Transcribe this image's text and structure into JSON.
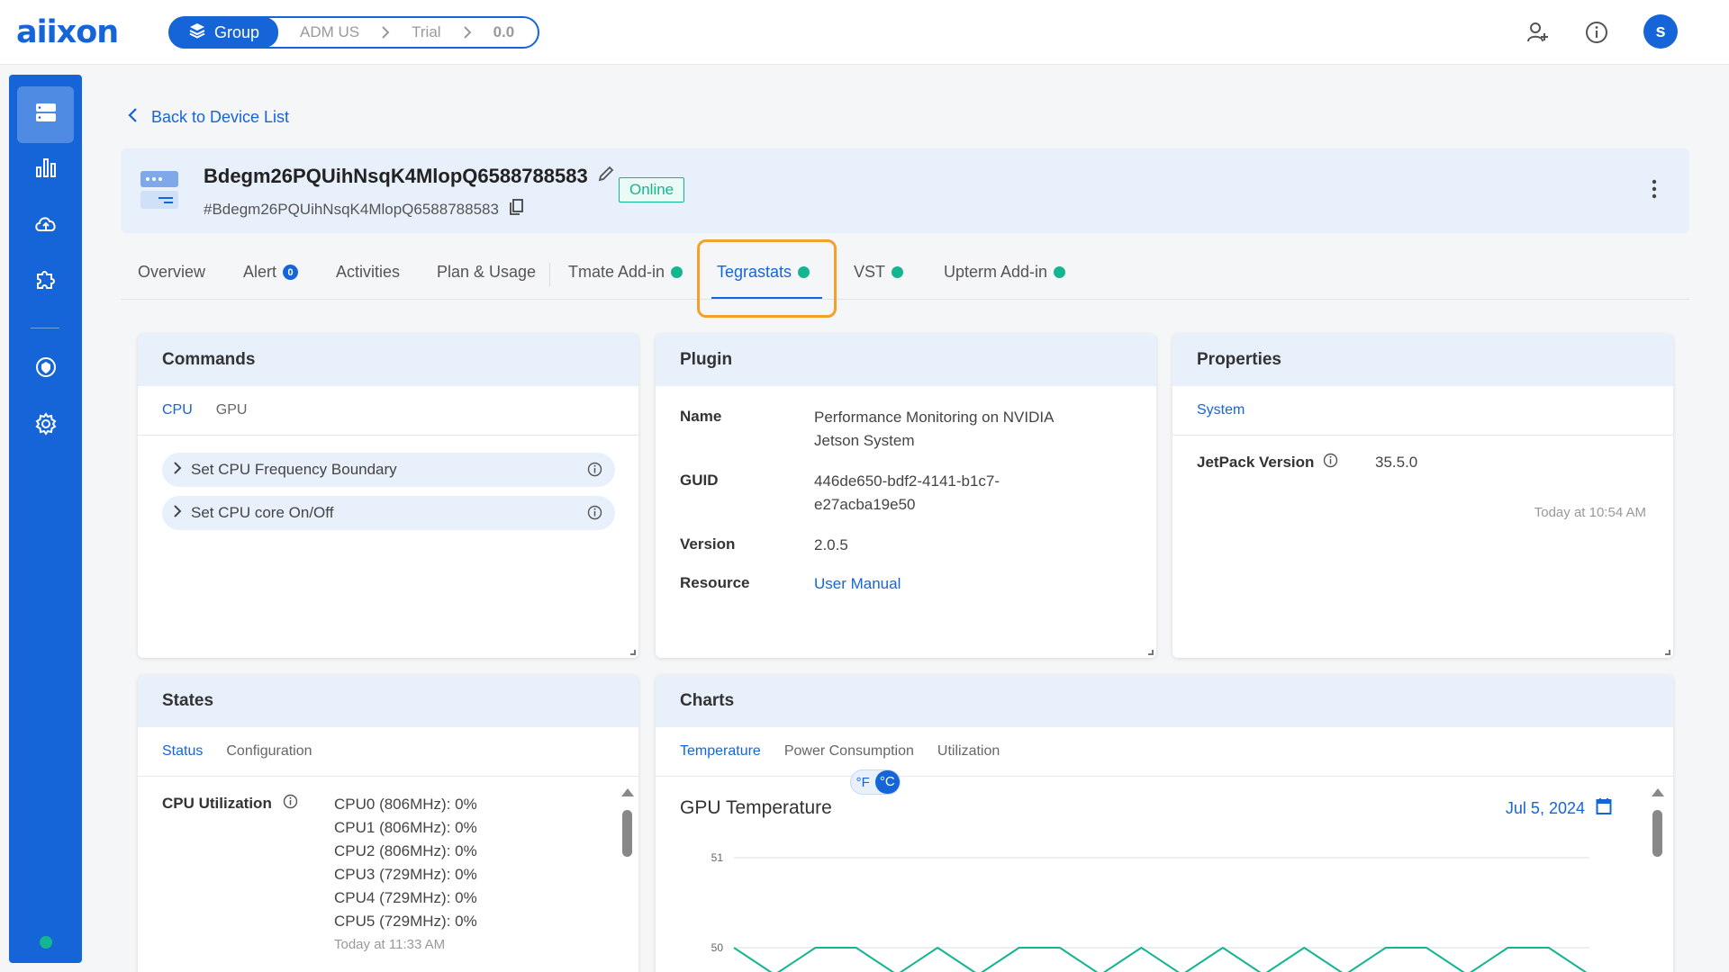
{
  "app": {
    "logo": "aiixon",
    "breadcrumb": {
      "group": "Group",
      "items": [
        "ADM US",
        "Trial",
        "0.0"
      ]
    },
    "user_initial": "s",
    "accent": "#1565d8",
    "status_color": "#16b591"
  },
  "sidebar": {
    "icons": [
      "devices-icon",
      "bar-chart-icon",
      "cloud-icon",
      "puzzle-icon",
      "shield-icon",
      "settings-icon"
    ]
  },
  "page": {
    "back_label": "Back to Device List",
    "device_name": "Bdegm26PQUihNsqK4MlopQ6588788583",
    "device_id": "#Bdegm26PQUihNsqK4MlopQ6588788583",
    "status": "Online"
  },
  "tabs": [
    {
      "label": "Overview"
    },
    {
      "label": "Alert",
      "badge": "0"
    },
    {
      "label": "Activities"
    },
    {
      "label": "Plan & Usage"
    },
    {
      "label": "Tmate Add-in"
    },
    {
      "label": "Tegrastats"
    },
    {
      "label": "VST"
    },
    {
      "label": "Upterm Add-in"
    }
  ],
  "commands": {
    "title": "Commands",
    "tabs": [
      "CPU",
      "GPU"
    ],
    "items": [
      "Set CPU Frequency Boundary",
      "Set CPU core On/Off"
    ]
  },
  "plugin": {
    "title": "Plugin",
    "name_label": "Name",
    "name_line1": "Performance Monitoring on NVIDIA",
    "name_line2": "Jetson System",
    "guid_label": "GUID",
    "guid_line1": "446de650-bdf2-4141-b1c7-",
    "guid_line2": "e27acba19e50",
    "version_label": "Version",
    "version": "2.0.5",
    "resource_label": "Resource",
    "resource": "User Manual"
  },
  "properties": {
    "title": "Properties",
    "tabs": [
      "System"
    ],
    "jetpack_label": "JetPack Version",
    "jetpack_value": "35.5.0",
    "timestamp": "Today at 10:54 AM"
  },
  "states": {
    "title": "States",
    "tabs": [
      "Status",
      "Configuration"
    ],
    "cpu_label": "CPU Utilization",
    "cpu_lines": [
      "CPU0 (806MHz): 0%",
      "CPU1 (806MHz): 0%",
      "CPU2 (806MHz): 0%",
      "CPU3 (729MHz): 0%",
      "CPU4 (729MHz): 0%",
      "CPU5 (729MHz): 0%"
    ],
    "timestamp": "Today at 11:33 AM"
  },
  "charts": {
    "title": "Charts",
    "tabs": [
      "Temperature",
      "Power Consumption",
      "Utilization"
    ],
    "chart_title": "GPU Temperature",
    "unit_f": "°F",
    "unit_c": "°C",
    "date": "Jul 5, 2024"
  },
  "chart_data": {
    "type": "line",
    "title": "GPU Temperature",
    "ylim": [
      50,
      51
    ],
    "yticks": [
      51,
      50
    ],
    "grid": true,
    "series": [
      {
        "values": [
          50,
          49.7,
          50,
          50,
          49.7,
          50,
          49.7,
          50,
          50,
          49.7,
          50,
          49.7,
          50,
          49.7,
          50,
          49.7,
          50,
          50,
          49.7,
          50,
          50,
          49.7
        ]
      }
    ]
  }
}
